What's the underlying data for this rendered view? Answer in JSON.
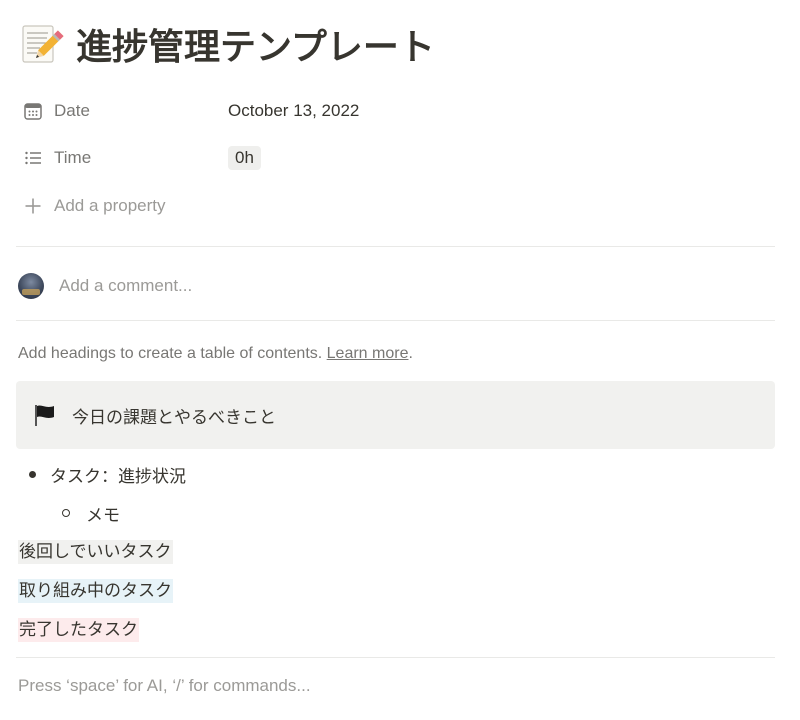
{
  "page": {
    "icon": "memo-pencil-icon",
    "title": "進捗管理テンプレート"
  },
  "properties": [
    {
      "icon": "calendar-icon",
      "name": "Date",
      "value": "October 13, 2022"
    },
    {
      "icon": "list-icon",
      "name": "Time",
      "value": "0h"
    }
  ],
  "add_property": {
    "icon": "plus-icon",
    "label": "Add a property"
  },
  "comment": {
    "placeholder": "Add a comment..."
  },
  "toc_hint": {
    "text": "Add headings to create a table of contents. ",
    "link": "Learn more",
    "suffix": "."
  },
  "callout": {
    "icon": "black-flag-icon",
    "text": "今日の課題とやるべきこと"
  },
  "bullets": [
    {
      "text": "タスク：進捗状況",
      "level": 1
    },
    {
      "text": "メモ",
      "level": 2
    }
  ],
  "highlights": [
    {
      "text": "後回しでいいタスク",
      "color": "#f1f1ef"
    },
    {
      "text": "取り組み中のタスク",
      "color": "#e7f3f8"
    },
    {
      "text": "完了したタスク",
      "color": "#fdebec"
    }
  ],
  "editor": {
    "placeholder": "Press ‘space’ for AI, ‘/’ for commands..."
  }
}
